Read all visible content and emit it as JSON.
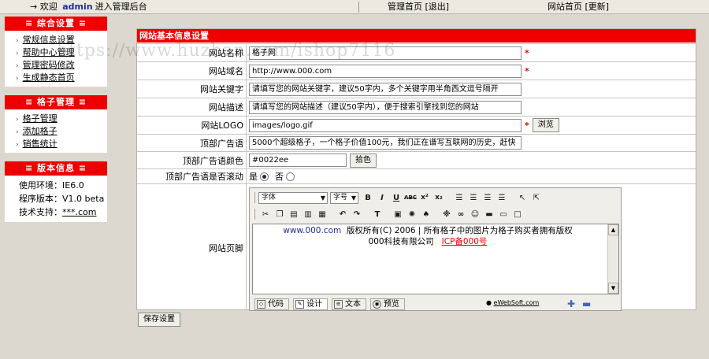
{
  "topbar": {
    "arrow": "→",
    "welcome_prefix": "欢迎",
    "user": "admin",
    "welcome_suffix": "进入管理后台",
    "admin_home": "管理首页",
    "logout": "[退出]",
    "site_home": "网站首页",
    "refresh": "[更新]"
  },
  "sidebar": {
    "general": {
      "title": "≡ 综合设置 ≡",
      "items": [
        "常规信息设置",
        "帮助中心管理",
        "管理密码修改",
        "生成静态首页"
      ]
    },
    "grid": {
      "title": "≡ 格子管理 ≡",
      "items": [
        "格子管理",
        "添加格子",
        "销售统计"
      ]
    },
    "version": {
      "title": "≡ 版本信息 ≡",
      "env_label": "使用环境：",
      "env_value": "IE6.0",
      "ver_label": "程序版本：",
      "ver_value": "V1.0 beta",
      "support_label": "技术支持：",
      "support_value": "***.com"
    }
  },
  "form": {
    "header": "网站基本信息设置",
    "site_name": {
      "label": "网站名称",
      "value": "格子网"
    },
    "site_domain": {
      "label": "网站域名",
      "value": "http://www.000.com"
    },
    "keywords": {
      "label": "网站关键字",
      "value": "请填写您的网站关键字，建议50字内，多个关键字用半角西文逗号隔开"
    },
    "description": {
      "label": "网站描述",
      "value": "请填写您的网站描述（建议50字内），便于搜索引擎找到您的网站"
    },
    "logo": {
      "label": "网站LOGO",
      "value": "images/logo.gif",
      "browse": "浏览"
    },
    "top_ad": {
      "label": "顶部广告语",
      "value": "5000个超级格子，一个格子价值100元，我们正在谱写互联网的历史，赶快"
    },
    "ad_color": {
      "label": "顶部广告语颜色",
      "value": "#0022ee",
      "pick": "拾色"
    },
    "ad_scroll": {
      "label": "顶部广告语是否滚动",
      "yes": "是",
      "no": "否",
      "selected": "yes"
    },
    "footer": {
      "label": "网站页脚",
      "font_select": "字体",
      "size_select": "字号",
      "content_link": "www.000.com",
      "content_line1": "版权所有(C) 2006 | 所有格子中的图片为格子购买者拥有版权",
      "content_company": "000科技有限公司",
      "content_icp": "ICP备000号",
      "tabs": [
        "代码",
        "设计",
        "文本",
        "预览"
      ],
      "brand": "eWebSoft.com"
    },
    "save": "保存设置"
  },
  "watermark": "https://www.huzhan.com/ishop7116",
  "colors": {
    "header_red": "#ee0000",
    "link_blue": "#1c2f9e"
  }
}
